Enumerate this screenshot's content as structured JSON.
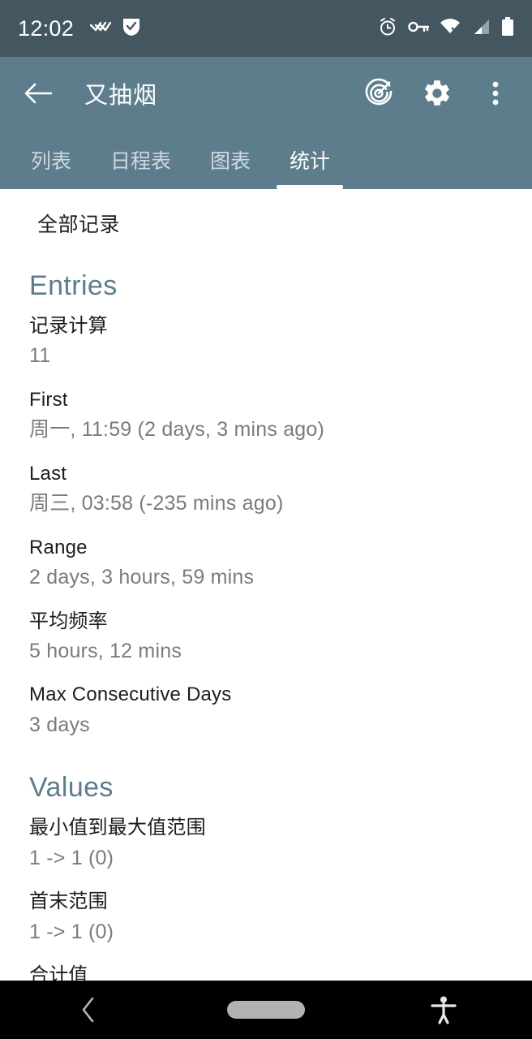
{
  "status_bar": {
    "clock": "12:02",
    "left_icons": [
      "notification-wings-icon",
      "notification-check-icon"
    ],
    "right_icons": [
      "alarm-icon",
      "vpn-key-icon",
      "wifi-off-icon",
      "cellular-signal-icon",
      "battery-icon"
    ],
    "background": "#445761"
  },
  "app_bar": {
    "back_icon": "back-arrow-icon",
    "title": "又抽烟",
    "actions": [
      {
        "name": "goal-target-icon",
        "label": "Goals"
      },
      {
        "name": "settings-gear-icon",
        "label": "Settings"
      },
      {
        "name": "overflow-menu-icon",
        "label": "More options"
      }
    ],
    "background": "#5e7d8c"
  },
  "tabs": [
    {
      "label": "列表",
      "active": false
    },
    {
      "label": "日程表",
      "active": false
    },
    {
      "label": "图表",
      "active": false
    },
    {
      "label": "统计",
      "active": true
    }
  ],
  "content": {
    "scope_label": "全部记录",
    "sections": [
      {
        "title": "Entries",
        "rows": [
          {
            "label": "记录计算",
            "value": "11"
          },
          {
            "label": "First",
            "value": "周一, 11:59 (2 days, 3 mins ago)"
          },
          {
            "label": "Last",
            "value": "周三, 03:58 (-235 mins ago)"
          },
          {
            "label": "Range",
            "value": "2 days, 3 hours, 59 mins"
          },
          {
            "label": "平均频率",
            "value": "5 hours, 12 mins"
          },
          {
            "label": "Max Consecutive Days",
            "value": "3 days"
          }
        ]
      },
      {
        "title": "Values",
        "rows": [
          {
            "label": "最小值到最大值范围",
            "value": "1 -> 1 (0)"
          },
          {
            "label": "首末范围",
            "value": "1 -> 1 (0)"
          },
          {
            "label": "合计值",
            "value": ""
          }
        ]
      }
    ]
  },
  "nav_bar": {
    "back_icon": "nav-back-icon",
    "home_icon": "nav-home-pill-icon",
    "accessibility_icon": "nav-accessibility-icon",
    "background": "#000000"
  },
  "colors": {
    "accent": "#5e7d8c",
    "status_bar": "#445761",
    "label_text": "#1d1d1d",
    "value_text": "#7b7b7b",
    "content_bg": "#ffffff"
  }
}
